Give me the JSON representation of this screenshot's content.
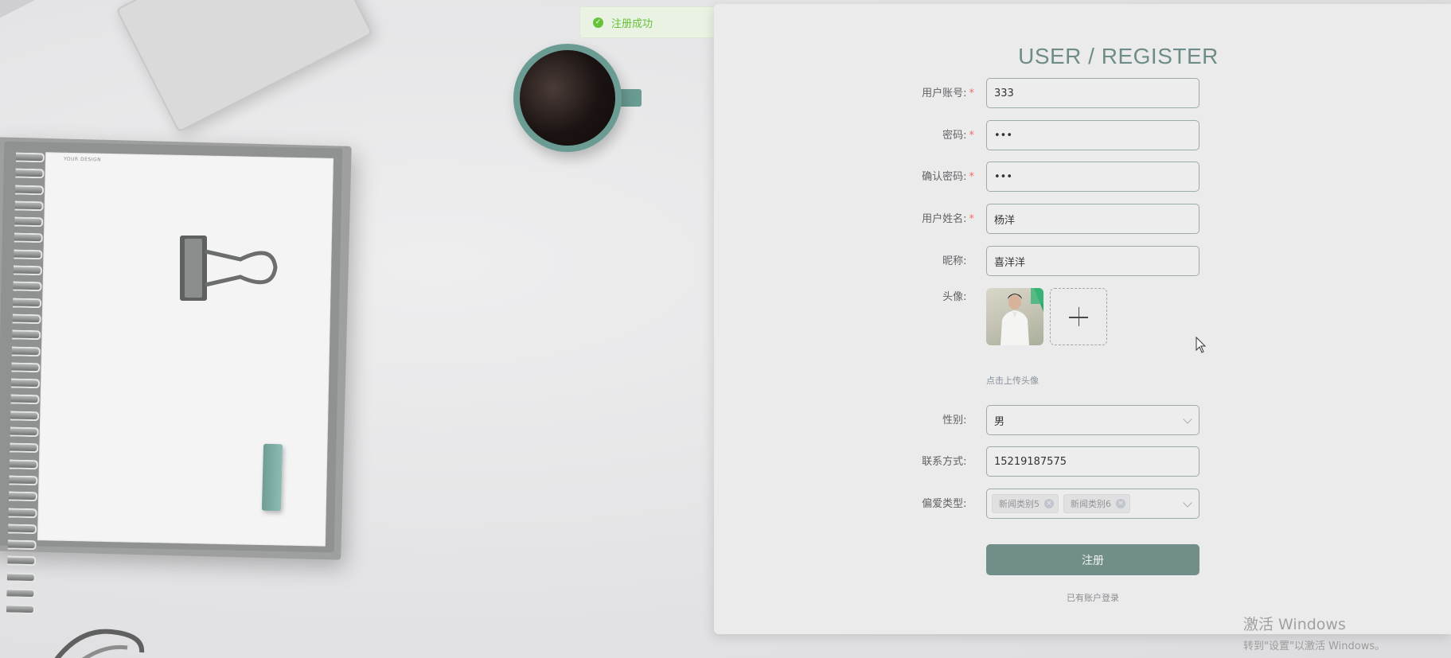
{
  "toast": {
    "text": "注册成功"
  },
  "title": "USER / REGISTER",
  "form": {
    "account": {
      "label": "用户账号:",
      "value": "333"
    },
    "password": {
      "label": "密码:",
      "value": "•••"
    },
    "confirm_password": {
      "label": "确认密码:",
      "value": "•••"
    },
    "real_name": {
      "label": "用户姓名:",
      "value": "杨洋"
    },
    "nickname": {
      "label": "昵称:",
      "value": "喜洋洋"
    },
    "avatar": {
      "label": "头像:",
      "hint": "点击上传头像"
    },
    "gender": {
      "label": "性别:",
      "value": "男"
    },
    "phone": {
      "label": "联系方式:",
      "value": "15219187575"
    },
    "preference": {
      "label": "偏爱类型:",
      "tags": [
        "新闻类别5",
        "新闻类别6"
      ]
    }
  },
  "submit_label": "注册",
  "login_link": "已有账户登录",
  "watermark": {
    "line1": "激活 Windows",
    "line2": "转到\"设置\"以激活 Windows。"
  },
  "required_mark": "*",
  "notebook_text": "YOUR DESIGN",
  "colors": {
    "accent": "#728e89",
    "title": "#6f8d88",
    "success": "#67c23a",
    "required": "#f56c6c"
  }
}
